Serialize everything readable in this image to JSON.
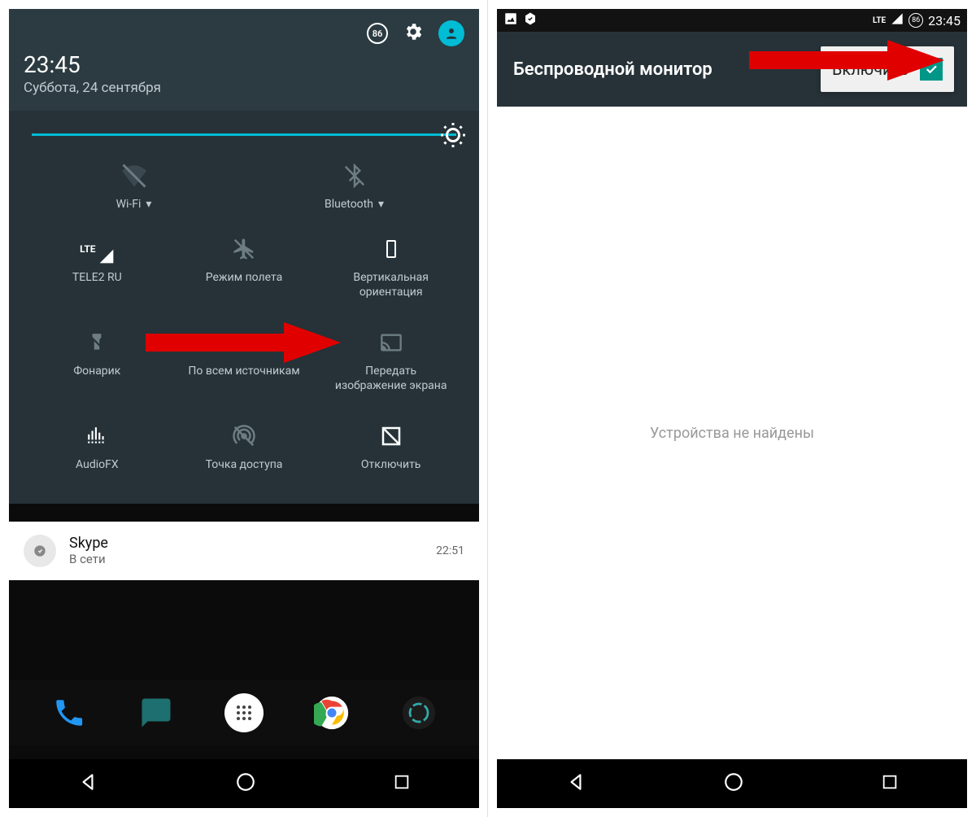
{
  "left": {
    "header": {
      "badge": "86",
      "time": "23:45",
      "date": "Суббота, 24 сентября"
    },
    "tiles": {
      "wifi": "Wi-Fi",
      "bluetooth": "Bluetooth",
      "cell": "TELE2 RU",
      "cell_band": "LTE",
      "airplane": "Режим полета",
      "rotation1": "Вертикальная",
      "rotation2": "ориентация",
      "flashlight": "Фонарик",
      "location": "По всем источникам",
      "cast1": "Передать",
      "cast2": "изображение экрана",
      "audiofx": "AudioFX",
      "hotspot": "Точка доступа",
      "sync": "Отключить"
    },
    "notification": {
      "title": "Skype",
      "sub": "В сети",
      "time": "22:51"
    }
  },
  "right": {
    "status": {
      "net": "LTE",
      "badge": "86",
      "time": "23:45"
    },
    "title": "Беспроводной монитор",
    "enable_label": "Включить",
    "body": "Устройства не найдены"
  }
}
